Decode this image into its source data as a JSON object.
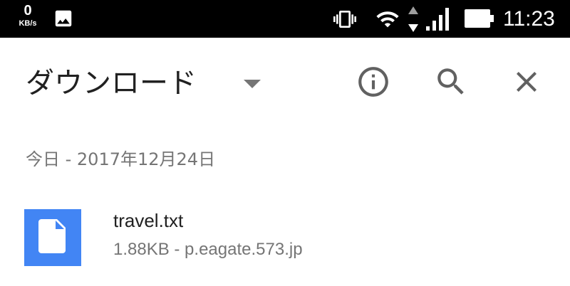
{
  "status_bar": {
    "net_speed_value": "0",
    "net_speed_unit": "KB/s",
    "time": "11:23",
    "icons": [
      "image-icon",
      "vibrate-icon",
      "wifi-icon",
      "data-transfer-icon",
      "signal-icon",
      "battery-icon"
    ]
  },
  "app_bar": {
    "title": "ダウンロード",
    "actions": [
      "dropdown-arrow-icon",
      "info-icon",
      "search-icon",
      "close-icon"
    ]
  },
  "section": {
    "header": "今日 - 2017年12月24日"
  },
  "downloads": [
    {
      "file_name": "travel.txt",
      "meta": "1.88KB - p.eagate.573.jp",
      "icon": "document-icon"
    }
  ],
  "colors": {
    "status_bar_bg": "#000000",
    "file_thumb_bg": "#4285f4",
    "primary_text": "#212121",
    "secondary_text": "#757575",
    "icon_gray": "#616161"
  }
}
